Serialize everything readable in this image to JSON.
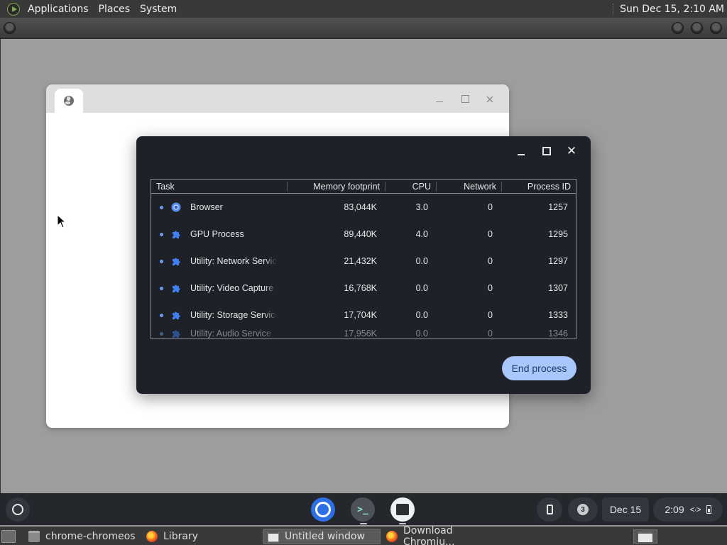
{
  "top_panel": {
    "menus": [
      "Applications",
      "Places",
      "System"
    ],
    "clock": "Sun Dec 15,  2:10 AM"
  },
  "browser_window": {
    "tab_icon": "globe-icon",
    "controls": {
      "minimize": "minimize-icon",
      "maximize": "maximize-icon",
      "close": "×"
    }
  },
  "task_manager": {
    "controls": {
      "minimize": "minimize-icon",
      "maximize": "maximize-icon",
      "close": "✕"
    },
    "columns": {
      "task": "Task",
      "memory": "Memory footprint",
      "cpu": "CPU",
      "network": "Network",
      "pid": "Process ID"
    },
    "rows": [
      {
        "icon": "chrome-icon",
        "task": "Browser",
        "memory": "83,044K",
        "cpu": "3.0",
        "network": "0",
        "pid": "1257"
      },
      {
        "icon": "puzzle-icon",
        "task": "GPU Process",
        "memory": "89,440K",
        "cpu": "4.0",
        "network": "0",
        "pid": "1295"
      },
      {
        "icon": "puzzle-icon",
        "task": "Utility: Network Service",
        "memory": "21,432K",
        "cpu": "0.0",
        "network": "0",
        "pid": "1297"
      },
      {
        "icon": "puzzle-icon",
        "task": "Utility: Video Capture",
        "memory": "16,768K",
        "cpu": "0.0",
        "network": "0",
        "pid": "1307"
      },
      {
        "icon": "puzzle-icon",
        "task": "Utility: Storage Service",
        "memory": "17,704K",
        "cpu": "0.0",
        "network": "0",
        "pid": "1333"
      },
      {
        "icon": "puzzle-icon",
        "task": "Utility: Audio Service",
        "memory": "17,956K",
        "cpu": "0.0",
        "network": "0",
        "pid": "1346"
      }
    ],
    "end_process_label": "End process",
    "colors": {
      "background": "#1e2127",
      "accent": "#a8c7fa",
      "bullet": "#6d9cf5"
    }
  },
  "shelf": {
    "apps": [
      "chrome-icon",
      "terminal-icon",
      "task-manager-icon"
    ],
    "terminal_glyph": ">_",
    "notification_count": "3",
    "date": "Dec 15",
    "time": "2:09",
    "network_glyph": "<·>"
  },
  "bottom_panel": {
    "tasks": [
      {
        "icon": "folder-icon",
        "label": "chrome-chromeos"
      },
      {
        "icon": "firefox-icon",
        "label": "Library"
      },
      {
        "icon": "window-icon",
        "label": "Untitled window"
      },
      {
        "icon": "firefox-icon",
        "label": "Download Chromiu..."
      }
    ]
  }
}
